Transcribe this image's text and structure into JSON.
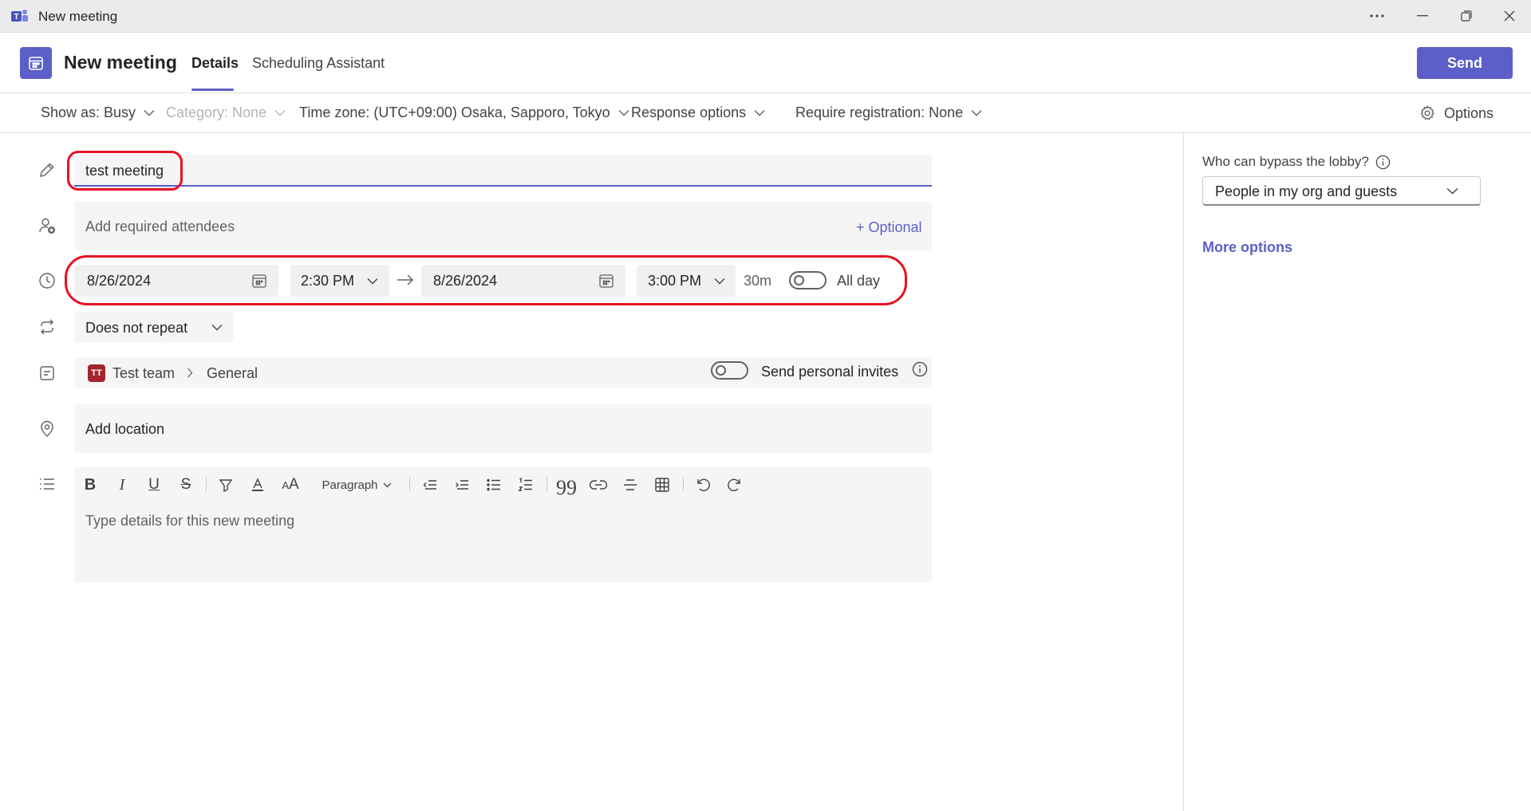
{
  "window": {
    "title": "New meeting",
    "controls": [
      "more-icon",
      "minimize-icon",
      "restore-icon",
      "close-icon"
    ]
  },
  "header": {
    "page_title": "New meeting",
    "tabs": [
      {
        "label": "Details",
        "selected": true
      },
      {
        "label": "Scheduling Assistant",
        "selected": false
      }
    ],
    "send_label": "Send"
  },
  "toolbar": {
    "show_as": "Show as: Busy",
    "category": "Category: None",
    "time_zone": "Time zone: (UTC+09:00) Osaka, Sapporo, Tokyo",
    "response_options": "Response options",
    "require_registration": "Require registration: None",
    "options_label": "Options"
  },
  "form": {
    "title_value": "test meeting",
    "attendees_placeholder": "Add required attendees",
    "optional_link": "+ Optional",
    "start_date": "8/26/2024",
    "start_time": "2:30 PM",
    "end_date": "8/26/2024",
    "end_time": "3:00 PM",
    "duration": "30m",
    "all_day_label": "All day",
    "all_day_on": false,
    "repeat": "Does not repeat",
    "team_badge": "TT",
    "team_name": "Test team",
    "channel_name": "General",
    "personal_invites_label": "Send personal invites",
    "personal_invites_on": false,
    "location_placeholder": "Add location",
    "editor_placeholder": "Type details for this new meeting",
    "paragraph_style": "Paragraph"
  },
  "right_panel": {
    "lobby_label": "Who can bypass the lobby?",
    "lobby_value": "People in my org and guests",
    "more_options": "More options"
  },
  "colors": {
    "accent": "#5b5fc7",
    "annotation": "#e81123",
    "team_badge": "#a4262c"
  }
}
